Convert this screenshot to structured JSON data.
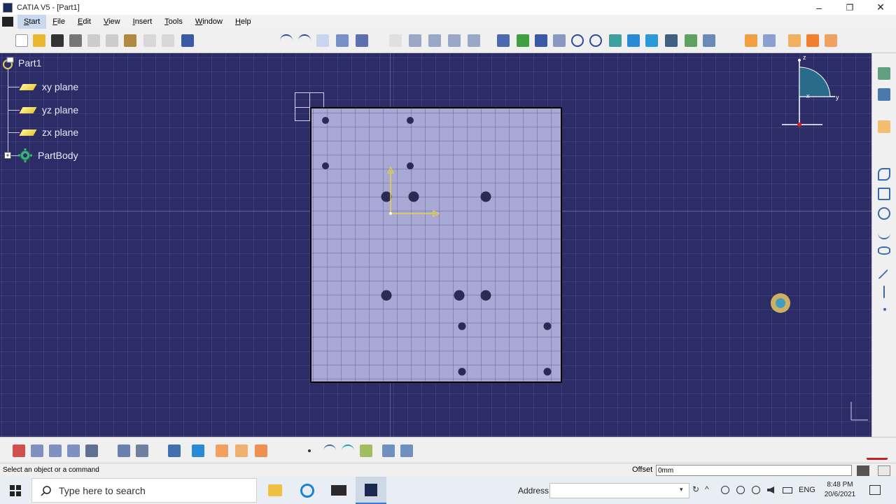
{
  "window": {
    "title": "CATIA V5 - [Part1]",
    "minimize": "–",
    "restore": "❐",
    "close": "✕"
  },
  "menu": {
    "items": [
      "Start",
      "File",
      "Edit",
      "View",
      "Insert",
      "Tools",
      "Window",
      "Help"
    ]
  },
  "tree": {
    "root": "Part1",
    "planes": [
      "xy plane",
      "yz plane",
      "zx plane"
    ],
    "body": "PartBody"
  },
  "compass": {
    "x": "x",
    "y": "y",
    "z": "z"
  },
  "status": {
    "message": "Select an object or a command",
    "offset_label": "Offset",
    "offset_value": "0mm"
  },
  "taskbar": {
    "search_placeholder": "Type here to search",
    "address_label": "Address",
    "language": "ENG",
    "time": "8:48 PM",
    "date": "20/6/2021"
  },
  "colors": {
    "viewport": "#2c2c66",
    "plate": "#a8a8d4",
    "hole": "#2a2a55",
    "sketch_axis": "#e6d23c"
  }
}
